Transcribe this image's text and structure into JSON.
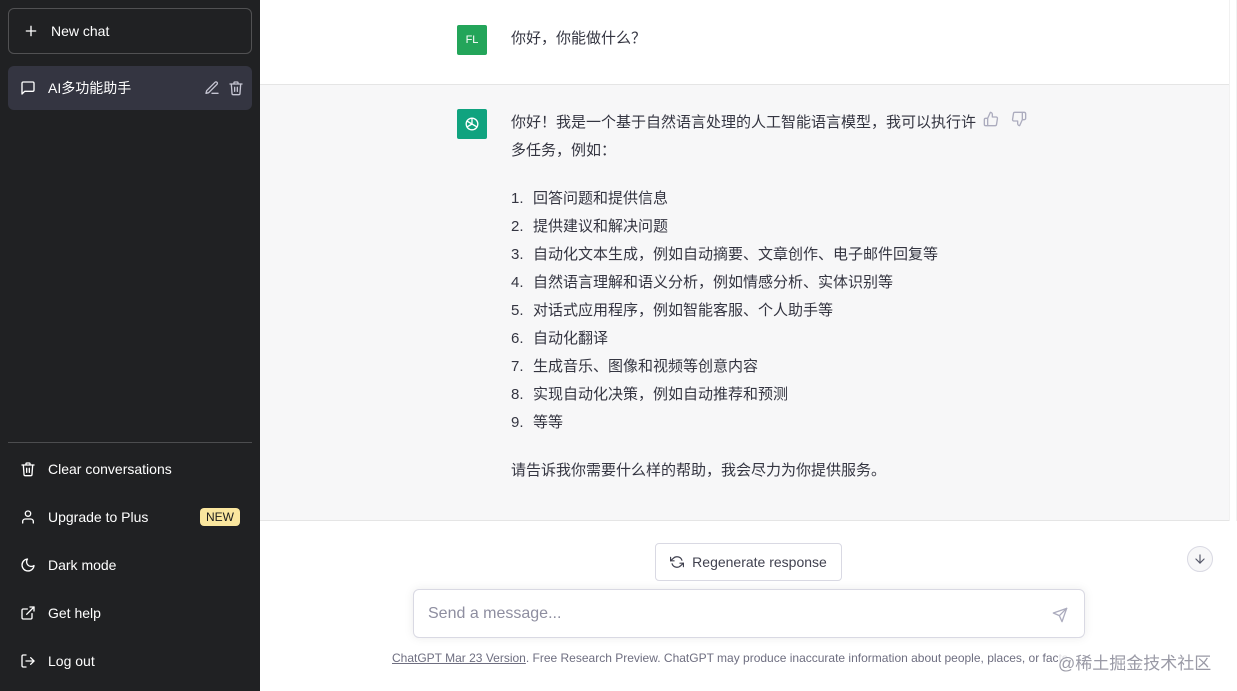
{
  "sidebar": {
    "new_chat_label": "New chat",
    "conversation_title": "AI多功能助手",
    "menu": {
      "clear": "Clear conversations",
      "upgrade": "Upgrade to Plus",
      "upgrade_badge": "NEW",
      "dark_mode": "Dark mode",
      "help": "Get help",
      "logout": "Log out"
    }
  },
  "chat": {
    "user_initials": "FL",
    "user_message": "你好，你能做什么？",
    "assistant_intro": "你好！我是一个基于自然语言处理的人工智能语言模型，我可以执行许多任务，例如：",
    "assistant_list": [
      {
        "num": "1.",
        "text": "回答问题和提供信息"
      },
      {
        "num": "2.",
        "text": "提供建议和解决问题"
      },
      {
        "num": "3.",
        "text": "自动化文本生成，例如自动摘要、文章创作、电子邮件回复等"
      },
      {
        "num": "4.",
        "text": "自然语言理解和语义分析，例如情感分析、实体识别等"
      },
      {
        "num": "5.",
        "text": "对话式应用程序，例如智能客服、个人助手等"
      },
      {
        "num": "6.",
        "text": "自动化翻译"
      },
      {
        "num": "7.",
        "text": "生成音乐、图像和视频等创意内容"
      },
      {
        "num": "8.",
        "text": "实现自动化决策，例如自动推荐和预测"
      },
      {
        "num": "9.",
        "text": "等等"
      }
    ],
    "assistant_outro": "请告诉我你需要什么样的帮助，我会尽力为你提供服务。"
  },
  "composer": {
    "regenerate_label": "Regenerate response",
    "placeholder": "Send a message..."
  },
  "footer": {
    "version_link": "ChatGPT Mar 23 Version",
    "disclaimer": ". Free Research Preview. ChatGPT may produce inaccurate information about people, places, or facts."
  },
  "watermark": "@稀土掘金技术社区",
  "colors": {
    "sidebar_bg": "#202123",
    "accent": "#10a37f",
    "user_avatar": "#23a55a",
    "badge": "#fae69e"
  }
}
